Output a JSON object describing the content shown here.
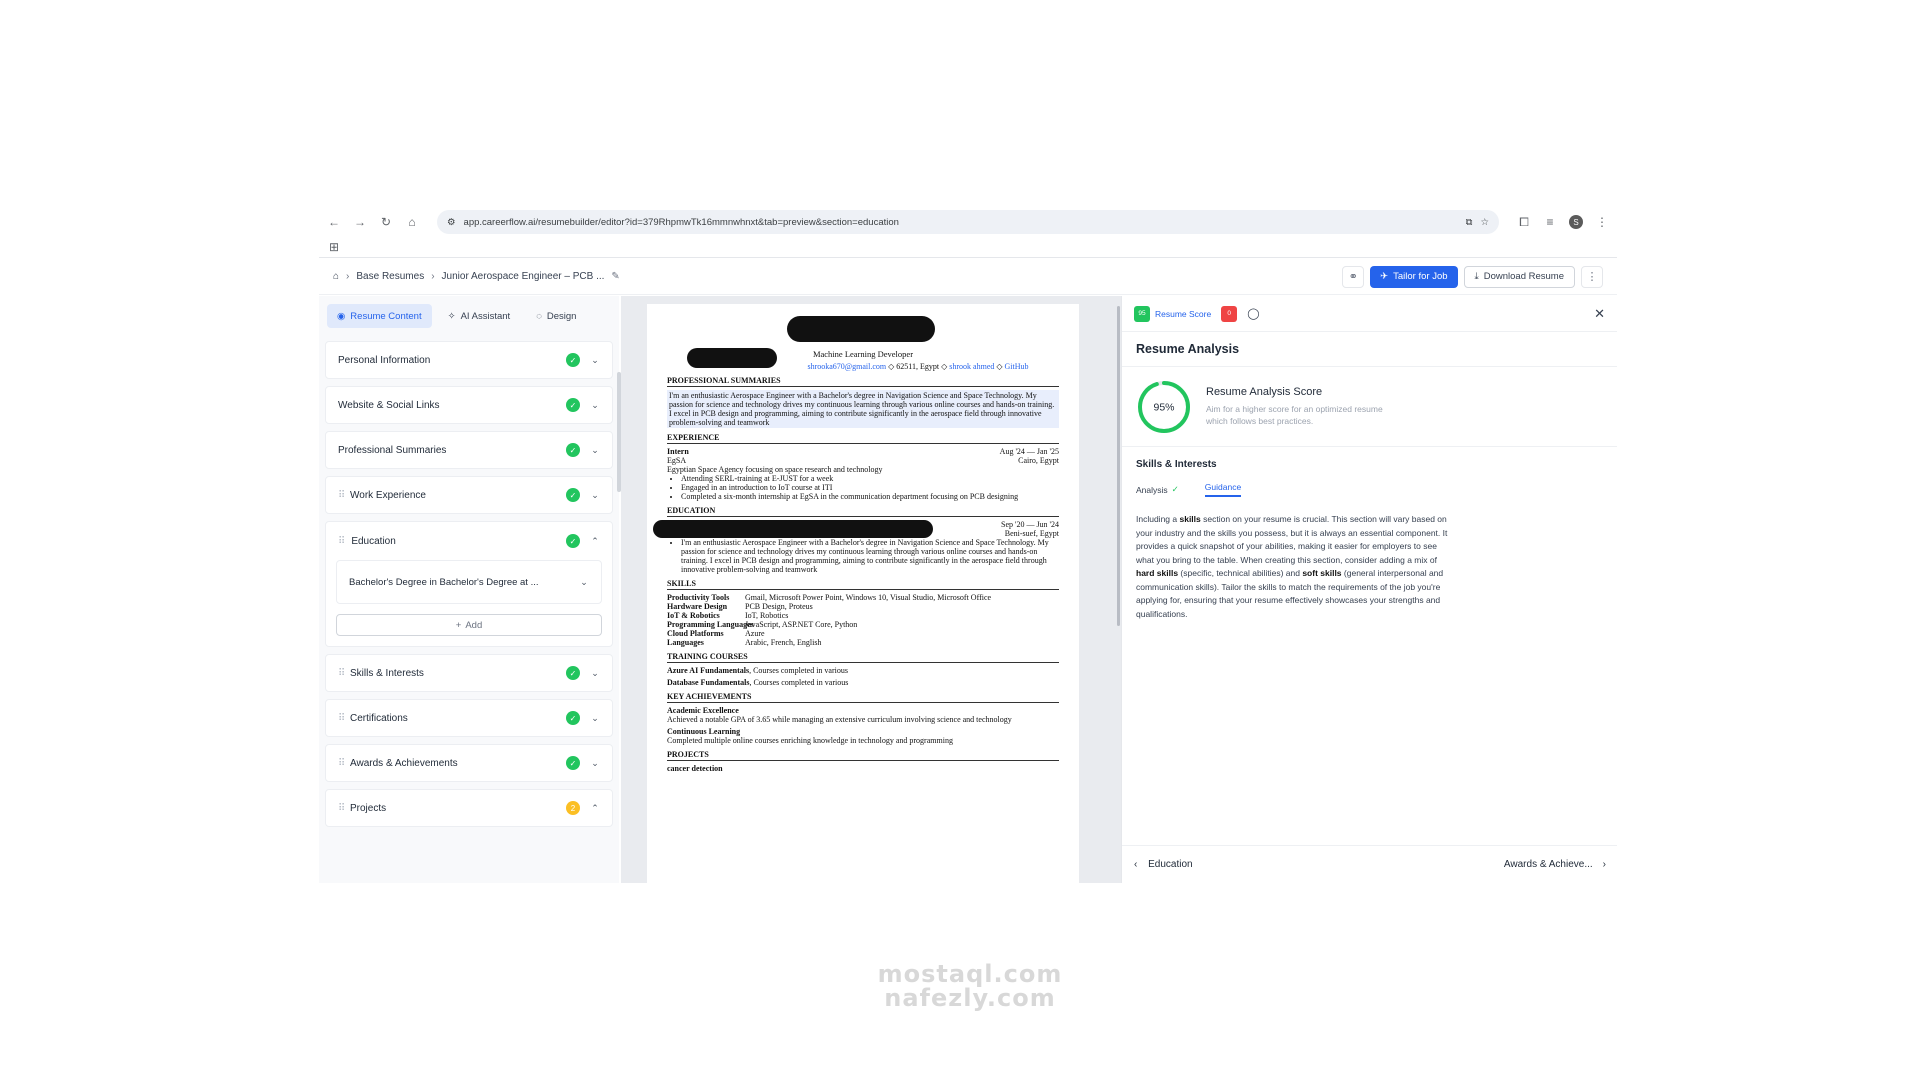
{
  "browser": {
    "url": "app.careerflow.ai/resumebuilder/editor?id=379RhpmwTk16mmnwhnxt&tab=preview&section=education",
    "profile_initial": "S"
  },
  "header": {
    "breadcrumb": [
      "Base Resumes",
      "Junior Aerospace Engineer – PCB ..."
    ],
    "tailor_label": "Tailor for Job",
    "download_label": "Download Resume"
  },
  "left_tabs": [
    "Resume Content",
    "AI Assistant",
    "Design"
  ],
  "sections": {
    "personal": "Personal Information",
    "links": "Website & Social Links",
    "summaries": "Professional Summaries",
    "work": "Work Experience",
    "education": "Education",
    "degree": "Bachelor's Degree in Bachelor's Degree at ...",
    "add": "Add",
    "skills": "Skills & Interests",
    "certs": "Certifications",
    "awards": "Awards & Achievements",
    "projects": "Projects",
    "projects_count": "2"
  },
  "resume": {
    "role": "Machine Learning Developer",
    "email": "shrooka670@gmail.com",
    "location": "62511, Egypt",
    "linkedin": "shrook ahmed",
    "github": "GitHub",
    "h_summary": "PROFESSIONAL SUMMARIES",
    "summary": "I'm an enthusiastic Aerospace Engineer with a Bachelor's degree in Navigation Science and Space Technology. My passion for science and technology drives my continuous learning through various online courses and hands-on training. I excel in PCB design and programming, aiming to contribute significantly in the aerospace field through innovative problem-solving and teamwork",
    "h_experience": "EXPERIENCE",
    "job_title": "Intern",
    "job_dates": "Aug '24 — Jan '25",
    "job_company": "EgSA",
    "job_location": "Cairo, Egypt",
    "job_desc": "Egyptian Space Agency focusing on space research and technology",
    "job_bullets": [
      "Attending SERL-training at E-JUST for a week",
      "Engaged in an introduction to IoT course at ITI",
      "Completed a six-month internship at EgSA in the communication department focusing on PCB designing"
    ],
    "h_education": "EDUCATION",
    "edu_dates": "Sep '20 — Jun '24",
    "edu_location": "Beni-suef, Egypt",
    "edu_bullet": "I'm an enthusiastic Aerospace Engineer with a Bachelor's degree in Navigation Science and Space Technology. My passion for science and technology drives my continuous learning through various online courses and hands-on training. I excel in PCB design and programming, aiming to contribute significantly in the aerospace field through innovative problem-solving and teamwork",
    "h_skills": "SKILLS",
    "skills": [
      {
        "k": "Productivity Tools",
        "v": "Gmail, Microsoft Power Point, Windows 10, Visual Studio, Microsoft Office"
      },
      {
        "k": "Hardware Design",
        "v": "PCB Design, Proteus"
      },
      {
        "k": "IoT & Robotics",
        "v": "IoT, Robotics"
      },
      {
        "k": "Programming Languages",
        "v": "JavaScript, ASP.NET Core, Python"
      },
      {
        "k": "Cloud Platforms",
        "v": "Azure"
      },
      {
        "k": "Languages",
        "v": "Arabic, French, English"
      }
    ],
    "h_training": "TRAINING COURSES",
    "training": [
      {
        "k": "Azure AI Fundamentals",
        "v": ", Courses completed in various"
      },
      {
        "k": "Database Fundamentals",
        "v": ", Courses completed in various"
      }
    ],
    "h_achievements": "KEY ACHIEVEMENTS",
    "ach1_title": "Academic Excellence",
    "ach1_desc": "Achieved a notable GPA of 3.65 while managing an extensive curriculum involving science and technology",
    "ach2_title": "Continuous Learning",
    "ach2_desc": "Completed multiple online courses enriching knowledge in technology and programming",
    "h_projects": "PROJECTS",
    "project1": "cancer detection"
  },
  "analysis": {
    "tab_label": "Resume Score",
    "score_chip": "95",
    "issues_chip": "0",
    "title": "Resume Analysis",
    "score": 95,
    "score_label": "95%",
    "score_heading": "Resume Analysis Score",
    "score_sub": "Aim for a higher score for an optimized resume which follows best practices.",
    "section": "Skills & Interests",
    "sub_analysis": "Analysis",
    "sub_guidance": "Guidance",
    "g1": "Including a ",
    "g2": "skills",
    "g3": " section on your resume is crucial. This section will vary based on your industry and the skills you possess, but it is always an essential component. It provides a quick snapshot of your abilities, making it easier for employers to see what you bring to the table. When creating this section, consider adding a mix of ",
    "g4": "hard skills",
    "g5": " (specific, technical abilities) and ",
    "g6": "soft skills",
    "g7": " (general interpersonal and communication skills). Tailor the skills to match the requirements of the job you're applying for, ensuring that your resume effectively showcases your strengths and qualifications.",
    "prev": "Education",
    "next": "Awards & Achieve..."
  },
  "watermark": {
    "line1": "mostaql.com",
    "line2": "nafezly.com"
  },
  "colors": {
    "accent": "#2563eb",
    "ok": "#22c55e",
    "warn": "#fbbf24",
    "error": "#ef4444"
  }
}
